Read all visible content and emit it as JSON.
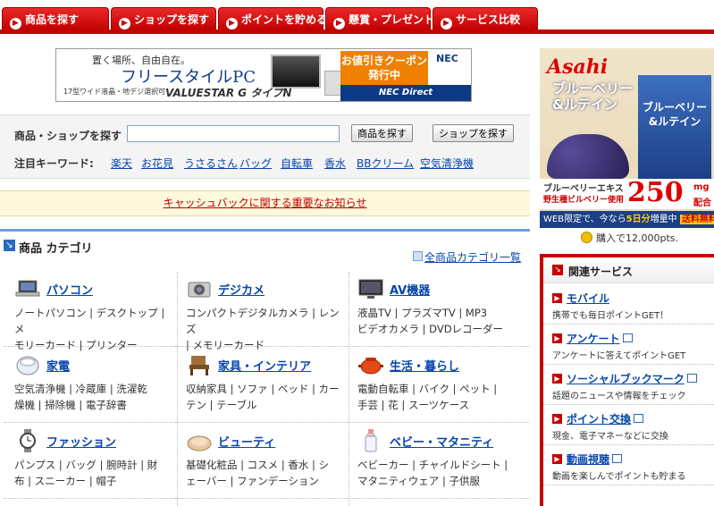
{
  "nav": {
    "tabs": [
      {
        "label": "商品を探す",
        "icon": "play-icon"
      },
      {
        "label": "ショップを探す",
        "icon": "play-icon"
      },
      {
        "label": "ポイントを貯める",
        "icon": "play-icon"
      },
      {
        "label": "懸賞・プレゼント",
        "icon": "play-icon"
      },
      {
        "label": "サービス比較",
        "icon": "play-icon"
      }
    ],
    "accent": "#c40000"
  },
  "banner": {
    "line1": "置く場所、自由自在。",
    "line2": "フリースタイルPC",
    "line3": "17型ワイド液晶・地デジ選択可",
    "line4": "VALUESTAR G タイプN",
    "coupon1": "お値引きクーポン",
    "coupon2": "発行中",
    "brand": "NEC",
    "direct": "NEC Direct"
  },
  "search": {
    "label": "商品・ショップを探す",
    "value": "",
    "placeholder": "",
    "btn_product": "商品を探す",
    "btn_shop": "ショップを探す",
    "kw_label": "注目キーワード:",
    "keywords": [
      "楽天",
      "お花見",
      "うさるさん",
      "バッグ",
      "自転車",
      "香水",
      "BBクリーム",
      "空気清浄機"
    ]
  },
  "notice": {
    "text": "キャッシュバックに関する重要なお知らせ"
  },
  "categories": {
    "title": "商品 カテゴリ",
    "all_link": "全商品カテゴリ一覧",
    "items": [
      {
        "name": "パソコン",
        "icon": "laptop-icon",
        "sub1": "ノートパソコン | デスクトップ | メ",
        "sub2": "モリーカード | プリンター"
      },
      {
        "name": "デジカメ",
        "icon": "camera-icon",
        "sub1": "コンパクトデジタルカメラ | レンズ",
        "sub2": " | メモリーカード"
      },
      {
        "name": "AV機器",
        "icon": "tv-icon",
        "sub1": "液晶TV | プラズマTV | MP3",
        "sub2": "ビデオカメラ | DVDレコーダー"
      },
      {
        "name": "家電",
        "icon": "rice-cooker-icon",
        "sub1": "空気清浄機 | 冷蔵庫 | 洗濯乾",
        "sub2": "燥機 | 掃除機 | 電子辞書"
      },
      {
        "name": "家具・インテリア",
        "icon": "chair-icon",
        "sub1": "収納家具 | ソファ | ベッド | カー",
        "sub2": "テン | テーブル"
      },
      {
        "name": "生活・暮らし",
        "icon": "pot-icon",
        "sub1": "電動自転車 | バイク | ペット |",
        "sub2": "手芸 | 花 | スーツケース"
      },
      {
        "name": "ファッション",
        "icon": "watch-icon",
        "sub1": "パンプス | バッグ | 腕時計 | 財",
        "sub2": "布 | スニーカー | 帽子"
      },
      {
        "name": "ビューティ",
        "icon": "compact-icon",
        "sub1": "基礎化粧品 | コスメ | 香水 | シ",
        "sub2": "ェーバー | ファンデーション"
      },
      {
        "name": "ベビー・マタニティ",
        "icon": "bottle-icon",
        "sub1": "ベビーカー | チャイルドシート |",
        "sub2": "マタニティウェア | 子供服"
      }
    ]
  },
  "right_ad": {
    "brand": "Asahi",
    "product1": "ブルーベリー",
    "product2": "&ルテイン",
    "pkg1": "ブルーベリー",
    "pkg2": "&ルテイン",
    "line1": "ブルーベリーエキス",
    "line2": "野生種ビルベリー使用",
    "amount": "250",
    "unit": "mg",
    "unit2": "配合",
    "bottom_a": "WEB限定で、今なら",
    "bottom_b": "5日分",
    "bottom_c": "増量中",
    "bottom_d": "送料無料"
  },
  "points": {
    "prefix": "購入で",
    "value": "12,000",
    "suffix": "pts."
  },
  "related": {
    "title": "関連サービス",
    "items": [
      {
        "title": "モバイル",
        "desc": "携帯でも毎日ポイントGET！",
        "ext": false
      },
      {
        "title": "アンケート",
        "desc": "アンケートに答えてポイントGET",
        "ext": true
      },
      {
        "title": "ソーシャルブックマーク",
        "desc": "話題のニュースや情報をチェック",
        "ext": true
      },
      {
        "title": "ポイント交換",
        "desc": "現金、電子マネーなどに交換",
        "ext": true
      },
      {
        "title": "動画視聴",
        "desc": "動画を楽しんでポイントも貯まる",
        "ext": true
      }
    ]
  }
}
